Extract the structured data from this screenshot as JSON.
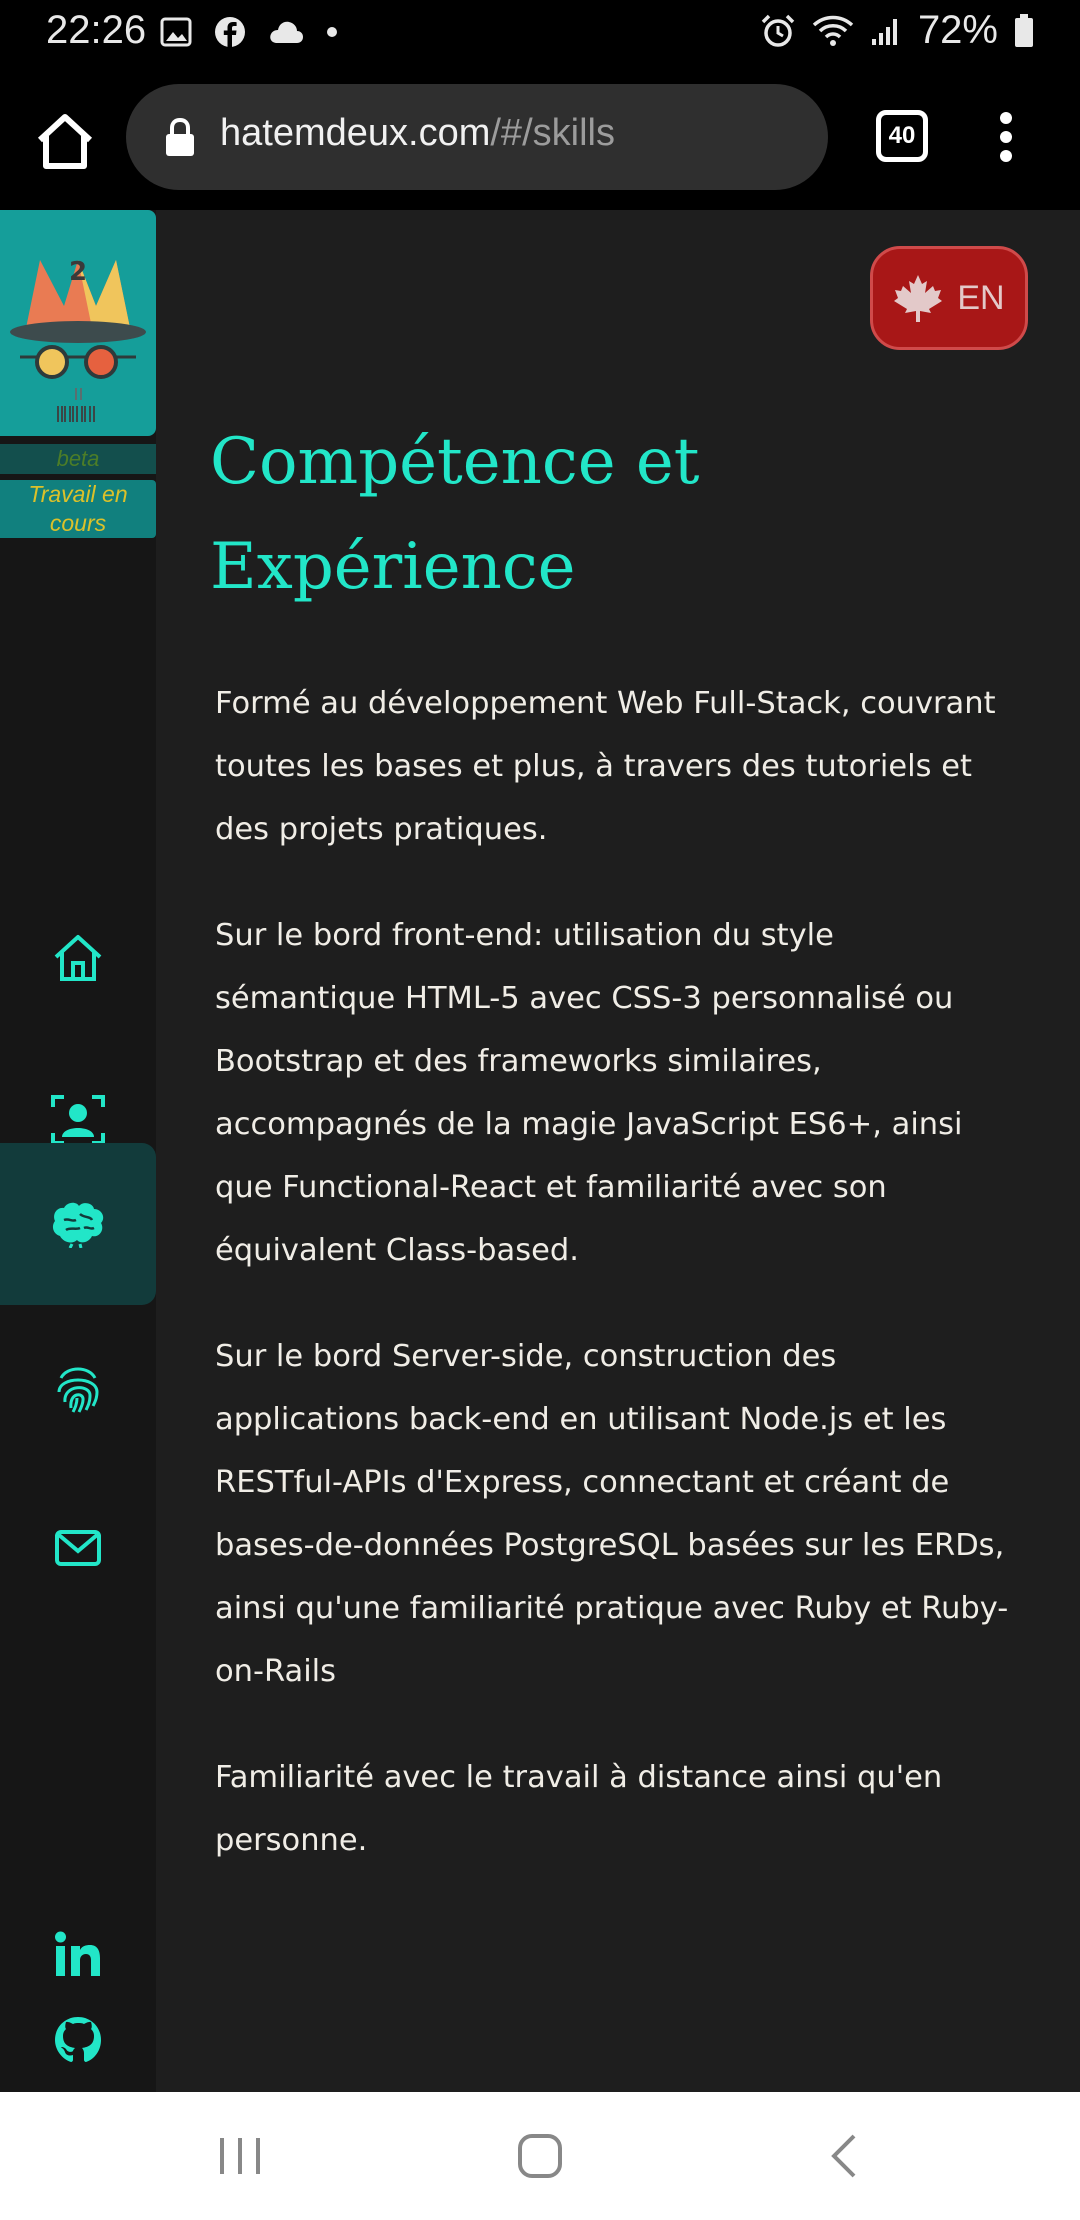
{
  "status_bar": {
    "time": "22:26",
    "left_icons": [
      "image-icon",
      "facebook-icon",
      "cloud-icon",
      "dot-icon"
    ],
    "right_icons": [
      "alarm-icon",
      "wifi-icon",
      "signal-icon",
      "battery-icon"
    ],
    "battery": "72%"
  },
  "browser": {
    "url_host": "hatemdeux.com",
    "url_path": "/#/skills",
    "tab_count": "40"
  },
  "sidebar": {
    "logo_mark": "2",
    "beta": "beta",
    "wip": "Travail en cours",
    "nav": [
      {
        "name": "home",
        "icon": "home-icon",
        "active": false
      },
      {
        "name": "about",
        "icon": "user-scan-icon",
        "active": false
      },
      {
        "name": "skills",
        "icon": "brain-icon",
        "active": true
      },
      {
        "name": "fingerprint",
        "icon": "fingerprint-icon",
        "active": false
      },
      {
        "name": "contact",
        "icon": "mail-icon",
        "active": false
      }
    ],
    "social": [
      "linkedin-icon",
      "github-icon"
    ]
  },
  "content": {
    "lang_label": "EN",
    "heading_line1": "Compétence et",
    "heading_line2": "Expérience",
    "paragraphs": [
      "Formé au développement Web Full-Stack, couvrant toutes les bases et plus, à travers des tutoriels et des projets pratiques.",
      "Sur le bord front-end: utilisation du style sémantique HTML-5 avec CSS-3 personnalisé ou Bootstrap et des frameworks similaires, accompagnés de la magie JavaScript ES6+, ainsi que Functional-React et familiarité avec son équivalent Class-based.",
      "Sur le bord Server-side, construction des applications back-end en utilisant Node.js et les RESTful-APIs d'Express, connectant et créant de bases-de-données PostgreSQL basées sur les ERDs, ainsi qu'une familiarité pratique avec Ruby et Ruby-on-Rails",
      "Familiarité avec le travail à distance ainsi qu'en personne."
    ]
  },
  "colors": {
    "accent": "#22e6c8",
    "page_bg": "#1e1e1e",
    "sidebar_bg": "#161616",
    "lang_button": "#a81717"
  }
}
